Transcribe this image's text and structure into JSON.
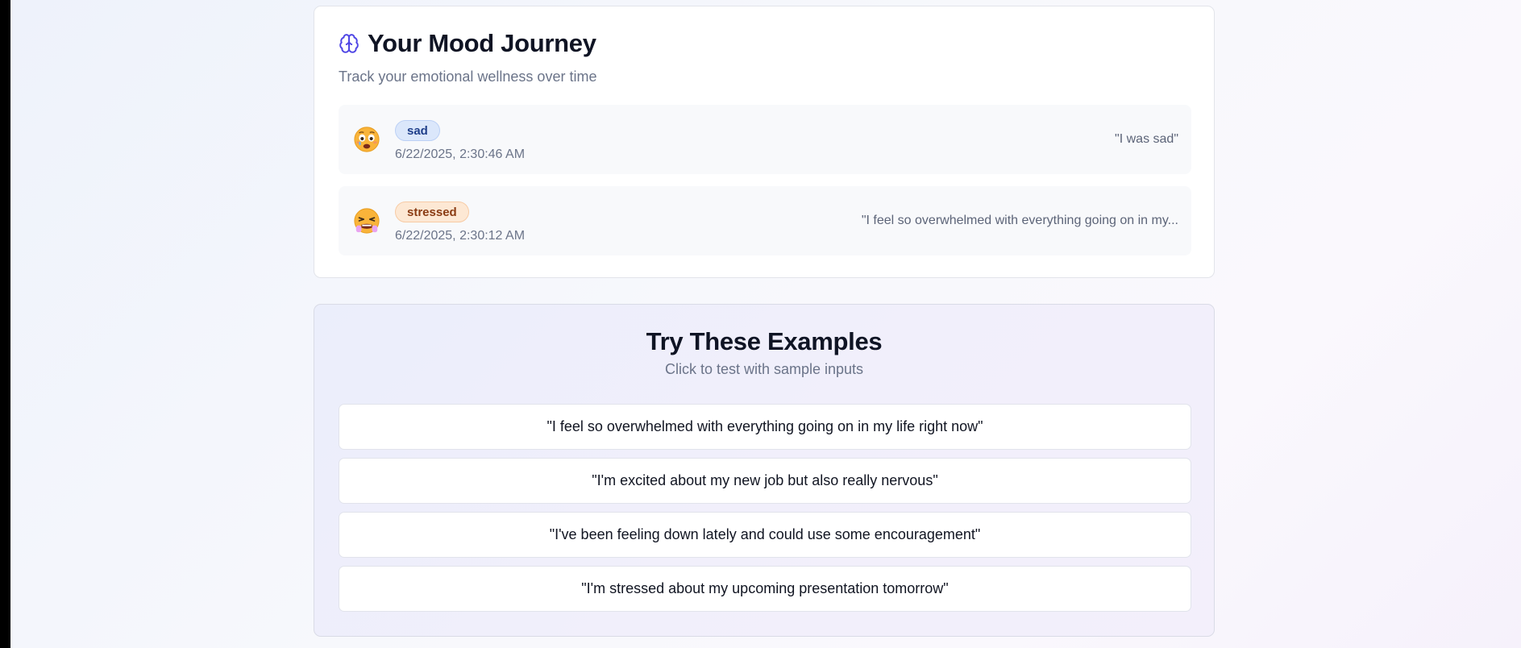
{
  "journey": {
    "title": "Your Mood Journey",
    "subtitle": "Track your emotional wellness over time",
    "icon": "brain-icon",
    "entries": [
      {
        "emoji": "😨",
        "emoji_name": "worried-face-icon",
        "mood": "sad",
        "timestamp": "6/22/2025, 2:30:46 AM",
        "quote": "\"I was sad\""
      },
      {
        "emoji": "😫",
        "emoji_name": "stressed-face-icon",
        "mood": "stressed",
        "timestamp": "6/22/2025, 2:30:12 AM",
        "quote": "\"I feel so overwhelmed with everything going on in my..."
      }
    ]
  },
  "examples": {
    "title": "Try These Examples",
    "subtitle": "Click to test with sample inputs",
    "items": [
      "\"I feel so overwhelmed with everything going on in my life right now\"",
      "\"I'm excited about my new job but also really nervous\"",
      "\"I've been feeling down lately and could use some encouragement\"",
      "\"I'm stressed about my upcoming presentation tomorrow\""
    ]
  },
  "colors": {
    "accent": "#4f46e5",
    "sad_tag_bg": "#dbe7fb",
    "sad_tag_text": "#1f3f8a",
    "stressed_tag_bg": "#fde8d4",
    "stressed_tag_text": "#8a3b12"
  }
}
